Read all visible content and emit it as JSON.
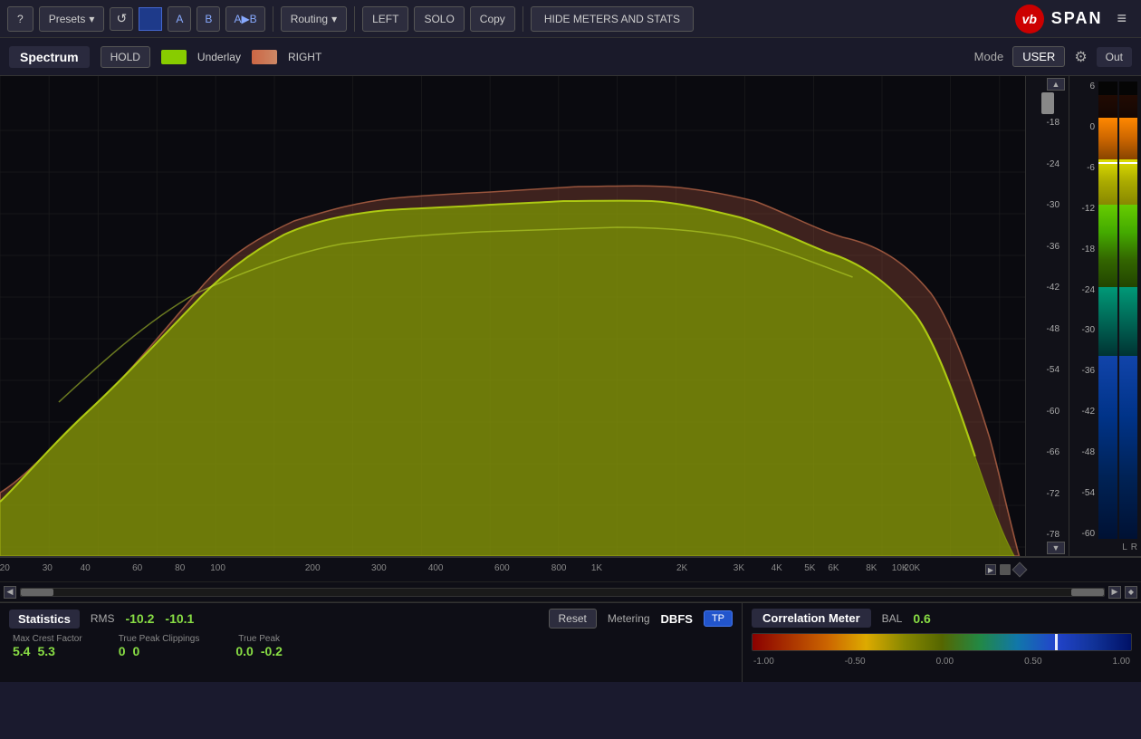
{
  "toolbar": {
    "help_label": "?",
    "presets_label": "Presets",
    "reset_label": "↺",
    "ab_a_label": "A",
    "ab_b_label": "B",
    "ab_arrow_label": "A▶B",
    "routing_label": "Routing",
    "left_label": "LEFT",
    "solo_label": "SOLO",
    "copy_label": "Copy",
    "hide_meters_label": "HIDE METERS AND STATS",
    "logo_icon": "vb",
    "logo_text": "SPAN",
    "menu_icon": "≡"
  },
  "spectrum_header": {
    "spectrum_label": "Spectrum",
    "hold_label": "HOLD",
    "underlay_label": "Underlay",
    "right_label": "RIGHT",
    "mode_label": "Mode",
    "mode_value": "USER",
    "out_label": "Out"
  },
  "db_scale": {
    "values": [
      "-18",
      "-24",
      "-30",
      "-36",
      "-42",
      "-48",
      "-54",
      "-60",
      "-66",
      "-72",
      "-78"
    ]
  },
  "vu_scale": {
    "values": [
      "6",
      "0",
      "-6",
      "-12",
      "-18",
      "-24",
      "-30",
      "-36",
      "-42",
      "-48",
      "-54",
      "-60"
    ]
  },
  "freq_axis": {
    "labels": [
      "20",
      "30",
      "40",
      "60",
      "80",
      "100",
      "200",
      "300",
      "400",
      "600",
      "800",
      "1K",
      "2K",
      "3K",
      "4K",
      "5K",
      "6K",
      "8K",
      "10K",
      "20K"
    ]
  },
  "statistics": {
    "label": "Statistics",
    "rms_label": "RMS",
    "rms_val1": "-10.2",
    "rms_val2": "-10.1",
    "reset_label": "Reset",
    "metering_label": "Metering",
    "dbfs_label": "DBFS",
    "tp_label": "TP",
    "max_crest_label": "Max Crest Factor",
    "max_crest_val1": "5.4",
    "max_crest_val2": "5.3",
    "true_peak_clip_label": "True Peak Clippings",
    "true_peak_clip_val1": "0",
    "true_peak_clip_val2": "0",
    "true_peak_label": "True Peak",
    "true_peak_val1": "0.0",
    "true_peak_val2": "-0.2"
  },
  "correlation": {
    "label": "Correlation Meter",
    "bal_label": "BAL",
    "bal_value": "0.6",
    "axis_labels": [
      "-1.00",
      "-0.50",
      "0.00",
      "0.50",
      "1.00"
    ]
  }
}
